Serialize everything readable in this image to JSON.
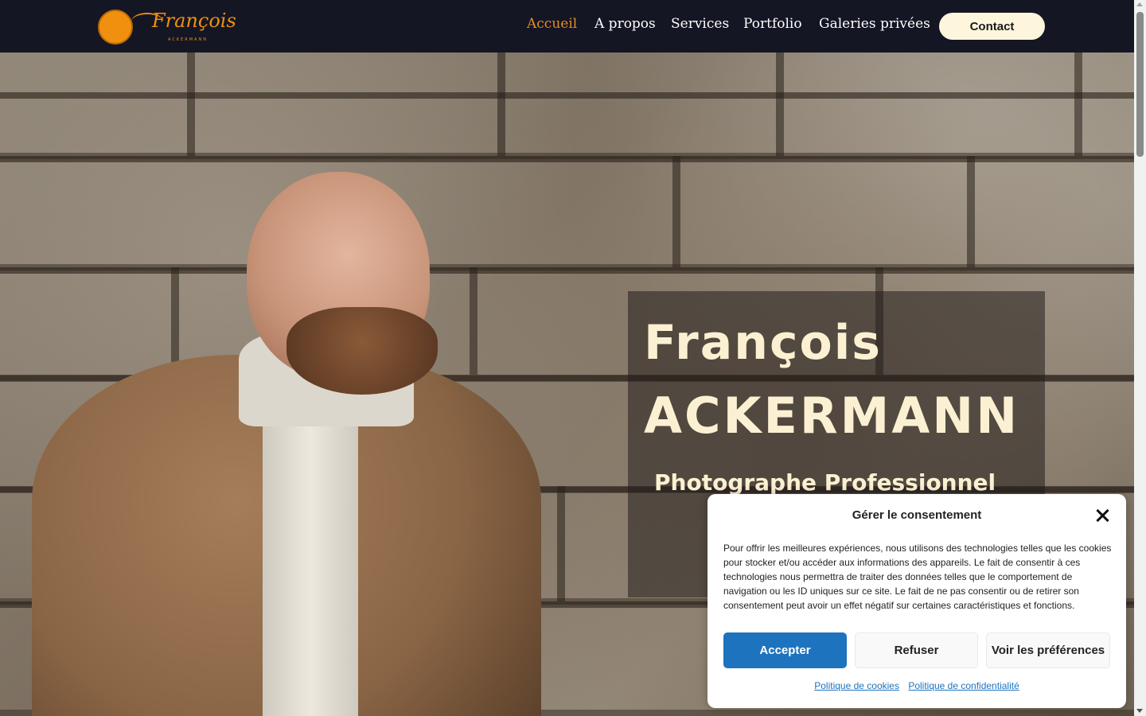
{
  "brand": {
    "logo_script": "François",
    "logo_sub": "ACKERMANN",
    "accent_color": "#e58b26"
  },
  "nav": {
    "items": [
      {
        "label": "Accueil",
        "active": true
      },
      {
        "label": "A propos",
        "active": false
      },
      {
        "label": "Services",
        "active": false
      },
      {
        "label": "Portfolio",
        "active": false
      },
      {
        "label": "Galeries privées",
        "active": false
      }
    ],
    "contact_label": "Contact"
  },
  "hero": {
    "first_name": "François",
    "last_name": "ACKERMANN",
    "subtitle": "Photographe Professionnel"
  },
  "consent": {
    "title": "Gérer le consentement",
    "text": "Pour offrir les meilleures expériences, nous utilisons des technologies telles que les cookies pour stocker et/ou accéder aux informations des appareils. Le fait de consentir à ces technologies nous permettra de traiter des données telles que le comportement de navigation ou les ID uniques sur ce site. Le fait de ne pas consentir ou de retirer son consentement peut avoir un effet négatif sur certaines caractéristiques et fonctions.",
    "accept_label": "Accepter",
    "refuse_label": "Refuser",
    "prefs_label": "Voir les préférences",
    "cookie_policy_label": "Politique de cookies",
    "privacy_policy_label": "Politique de confidentialité",
    "accept_color": "#1e73be"
  }
}
